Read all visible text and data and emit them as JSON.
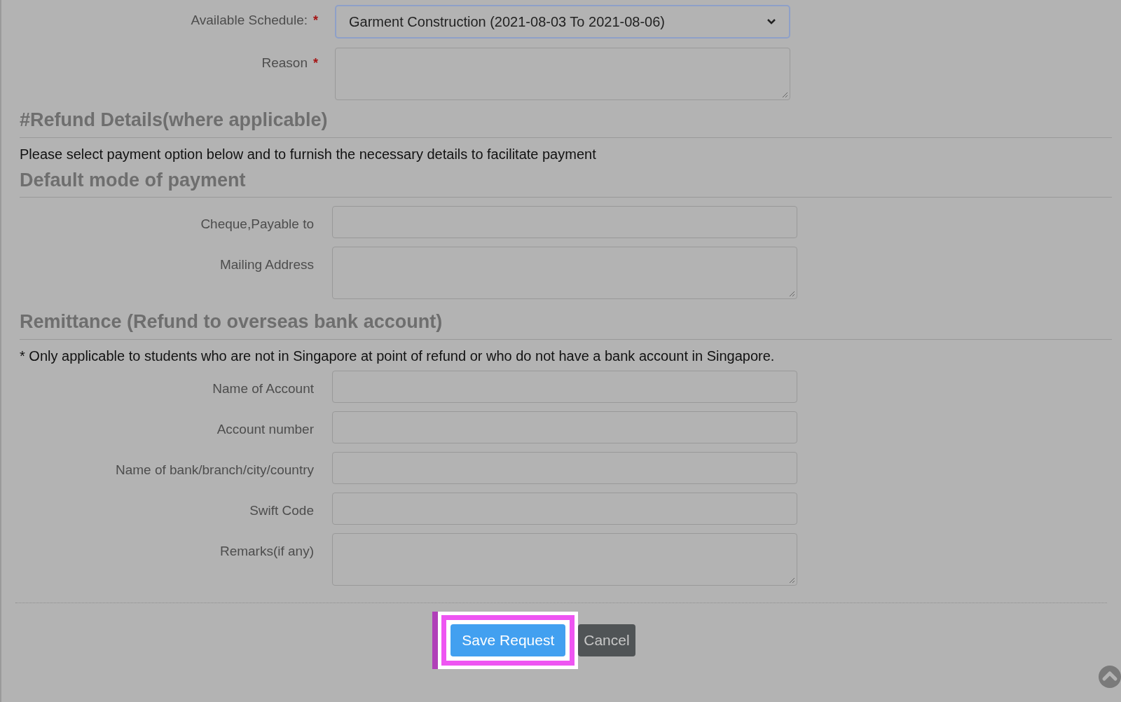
{
  "top_fields": [
    {
      "kind": "select",
      "label": "Available Schedule:",
      "required_mark": "*",
      "value": "Garment Construction (2021-08-03 To 2021-08-06)"
    },
    {
      "kind": "textarea",
      "label": "Reason",
      "required_mark": "*"
    }
  ],
  "sections": [
    {
      "heading": "#Refund Details(where applicable)",
      "note": "Please select payment option below and to furnish the necessary details to facilitate payment"
    },
    {
      "heading": "Default mode of payment",
      "fields": [
        {
          "kind": "input",
          "label": "Cheque,Payable to"
        },
        {
          "kind": "textarea",
          "label": "Mailing Address"
        }
      ]
    },
    {
      "heading": "Remittance (Refund to overseas bank account)",
      "note": "* Only applicable to students who are not in Singapore at point of refund or who do not have a bank account in Singapore.",
      "fields": [
        {
          "kind": "input",
          "label": "Name of Account"
        },
        {
          "kind": "input",
          "label": "Account number"
        },
        {
          "kind": "input",
          "label": "Name of bank/branch/city/country"
        },
        {
          "kind": "input",
          "label": "Swift Code"
        },
        {
          "kind": "textarea",
          "label": "Remarks(if any)"
        }
      ]
    }
  ],
  "buttons": [
    {
      "kind": "primary",
      "label": "Save Request",
      "highlighted": true
    },
    {
      "kind": "secondary",
      "label": "Cancel",
      "highlighted": false
    }
  ]
}
